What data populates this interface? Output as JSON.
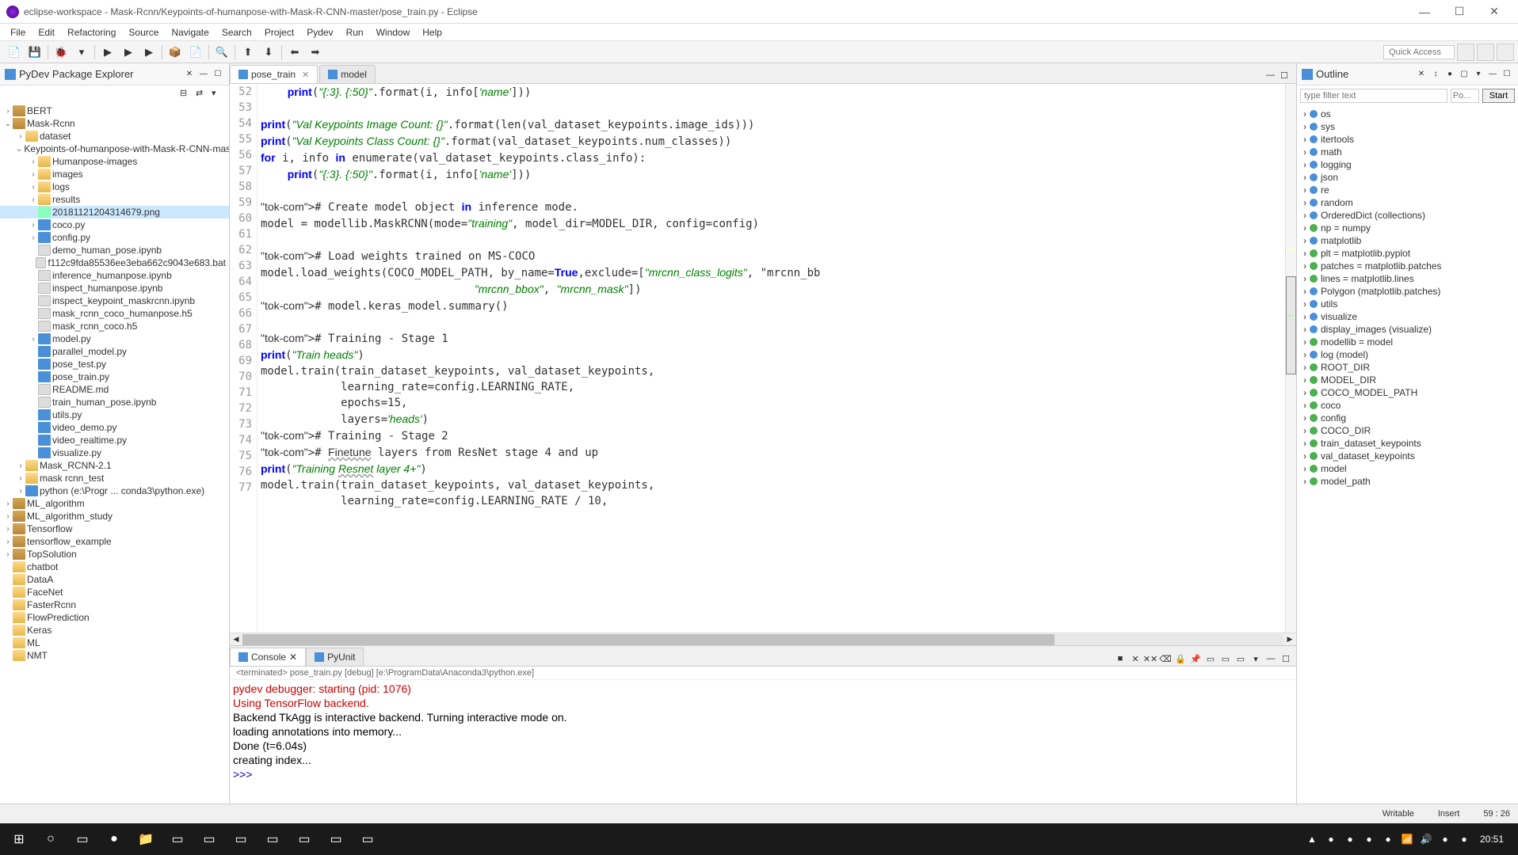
{
  "titlebar": {
    "text": "eclipse-workspace - Mask-Rcnn/Keypoints-of-humanpose-with-Mask-R-CNN-master/pose_train.py - Eclipse"
  },
  "menubar": [
    "File",
    "Edit",
    "Refactoring",
    "Source",
    "Navigate",
    "Search",
    "Project",
    "Pydev",
    "Run",
    "Window",
    "Help"
  ],
  "quick_access": "Quick Access",
  "pydev_panel_title": "PyDev Package Explorer",
  "project_tree": {
    "selected_file": "20181121204314679.png",
    "items": [
      {
        "l": 0,
        "a": "›",
        "i": "pkg",
        "t": "BERT"
      },
      {
        "l": 0,
        "a": "⌄",
        "i": "pkg",
        "t": "Mask-Rcnn"
      },
      {
        "l": 1,
        "a": "›",
        "i": "folder",
        "t": "dataset"
      },
      {
        "l": 1,
        "a": "⌄",
        "i": "folder",
        "t": "Keypoints-of-humanpose-with-Mask-R-CNN-master"
      },
      {
        "l": 2,
        "a": "›",
        "i": "folder",
        "t": "Humanpose-images"
      },
      {
        "l": 2,
        "a": "›",
        "i": "folder",
        "t": "images"
      },
      {
        "l": 2,
        "a": "›",
        "i": "folder",
        "t": "logs"
      },
      {
        "l": 2,
        "a": "›",
        "i": "folder",
        "t": "results"
      },
      {
        "l": 2,
        "a": "",
        "i": "img",
        "t": "20181121204314679.png",
        "sel": true
      },
      {
        "l": 2,
        "a": "›",
        "i": "pyfile",
        "t": "coco.py"
      },
      {
        "l": 2,
        "a": "›",
        "i": "pyfile",
        "t": "config.py"
      },
      {
        "l": 2,
        "a": "",
        "i": "file",
        "t": "demo_human_pose.ipynb"
      },
      {
        "l": 2,
        "a": "",
        "i": "file",
        "t": "f112c9fda85536ee3eba662c9043e683.bat"
      },
      {
        "l": 2,
        "a": "",
        "i": "file",
        "t": "inference_humanpose.ipynb"
      },
      {
        "l": 2,
        "a": "",
        "i": "file",
        "t": "inspect_humanpose.ipynb"
      },
      {
        "l": 2,
        "a": "",
        "i": "file",
        "t": "inspect_keypoint_maskrcnn.ipynb"
      },
      {
        "l": 2,
        "a": "",
        "i": "file",
        "t": "mask_rcnn_coco_humanpose.h5"
      },
      {
        "l": 2,
        "a": "",
        "i": "file",
        "t": "mask_rcnn_coco.h5"
      },
      {
        "l": 2,
        "a": "›",
        "i": "pyfile",
        "t": "model.py"
      },
      {
        "l": 2,
        "a": "",
        "i": "pyfile",
        "t": "parallel_model.py"
      },
      {
        "l": 2,
        "a": "",
        "i": "pyfile",
        "t": "pose_test.py"
      },
      {
        "l": 2,
        "a": "",
        "i": "pyfile",
        "t": "pose_train.py"
      },
      {
        "l": 2,
        "a": "",
        "i": "file",
        "t": "README.md"
      },
      {
        "l": 2,
        "a": "",
        "i": "file",
        "t": "train_human_pose.ipynb"
      },
      {
        "l": 2,
        "a": "",
        "i": "pyfile",
        "t": "utils.py"
      },
      {
        "l": 2,
        "a": "",
        "i": "pyfile",
        "t": "video_demo.py"
      },
      {
        "l": 2,
        "a": "",
        "i": "pyfile",
        "t": "video_realtime.py"
      },
      {
        "l": 2,
        "a": "",
        "i": "pyfile",
        "t": "visualize.py"
      },
      {
        "l": 1,
        "a": "›",
        "i": "folder",
        "t": "Mask_RCNN-2.1"
      },
      {
        "l": 1,
        "a": "›",
        "i": "folder",
        "t": "mask rcnn_test"
      },
      {
        "l": 1,
        "a": "›",
        "i": "pyfile",
        "t": "python  (e:\\Progr ... conda3\\python.exe)"
      },
      {
        "l": 0,
        "a": "›",
        "i": "pkg",
        "t": "ML_algorithm"
      },
      {
        "l": 0,
        "a": "›",
        "i": "pkg",
        "t": "ML_algorithm_study"
      },
      {
        "l": 0,
        "a": "›",
        "i": "pkg",
        "t": "Tensorflow"
      },
      {
        "l": 0,
        "a": "›",
        "i": "pkg",
        "t": "tensorflow_example"
      },
      {
        "l": 0,
        "a": "›",
        "i": "pkg",
        "t": "TopSolution"
      },
      {
        "l": 0,
        "a": "",
        "i": "folder",
        "t": "chatbot"
      },
      {
        "l": 0,
        "a": "",
        "i": "folder",
        "t": "DataA"
      },
      {
        "l": 0,
        "a": "",
        "i": "folder",
        "t": "FaceNet"
      },
      {
        "l": 0,
        "a": "",
        "i": "folder",
        "t": "FasterRcnn"
      },
      {
        "l": 0,
        "a": "",
        "i": "folder",
        "t": "FlowPrediction"
      },
      {
        "l": 0,
        "a": "",
        "i": "folder",
        "t": "Keras"
      },
      {
        "l": 0,
        "a": "",
        "i": "folder",
        "t": "ML"
      },
      {
        "l": 0,
        "a": "",
        "i": "folder",
        "t": "NMT"
      }
    ]
  },
  "editor": {
    "tabs": [
      {
        "label": "pose_train",
        "active": true
      },
      {
        "label": "model",
        "active": false
      }
    ],
    "first_line": 52,
    "code_raw": [
      "    print(\"{:3}. {:50}\".format(i, info['name']))",
      "",
      "print(\"Val Keypoints Image Count: {}\".format(len(val_dataset_keypoints.image_ids)))",
      "print(\"Val Keypoints Class Count: {}\".format(val_dataset_keypoints.num_classes))",
      "for i, info in enumerate(val_dataset_keypoints.class_info):",
      "    print(\"{:3}. {:50}\".format(i, info['name']))",
      "",
      "# Create model object in inference mode.",
      "model = modellib.MaskRCNN(mode=\"training\", model_dir=MODEL_DIR, config=config)",
      "",
      "# Load weights trained on MS-COCO",
      "model.load_weights(COCO_MODEL_PATH, by_name=True,exclude=[\"mrcnn_class_logits\", \"mrcnn_bb",
      "                                \"mrcnn_bbox\", \"mrcnn_mask\"])",
      "# model.keras_model.summary()",
      "",
      "# Training - Stage 1",
      "print(\"Train heads\")",
      "model.train(train_dataset_keypoints, val_dataset_keypoints,",
      "            learning_rate=config.LEARNING_RATE,",
      "            epochs=15,",
      "            layers='heads')",
      "# Training - Stage 2",
      "# Finetune layers from ResNet stage 4 and up",
      "print(\"Training Resnet layer 4+\")",
      "model.train(train_dataset_keypoints, val_dataset_keypoints,",
      "            learning_rate=config.LEARNING_RATE / 10,"
    ]
  },
  "console": {
    "tab_console": "Console",
    "tab_pyunit": "PyUnit",
    "status": "<terminated> pose_train.py [debug] [e:\\ProgramData\\Anaconda3\\python.exe]",
    "lines": [
      {
        "c": "red",
        "t": "pydev debugger: starting (pid: 1076)"
      },
      {
        "c": "red",
        "t": "Using TensorFlow backend."
      },
      {
        "c": "out",
        "t": "Backend TkAgg is interactive backend. Turning interactive mode on."
      },
      {
        "c": "out",
        "t": "loading annotations into memory..."
      },
      {
        "c": "out",
        "t": "Done (t=6.04s)"
      },
      {
        "c": "out",
        "t": "creating index..."
      },
      {
        "c": "out",
        "t": ""
      },
      {
        "c": "blue",
        "t": ">>> "
      }
    ]
  },
  "outline": {
    "title": "Outline",
    "filter_placeholder": "type filter text",
    "filter2_placeholder": "Po...",
    "start_btn": "Start",
    "items": [
      "os",
      "sys",
      "itertools",
      "math",
      "logging",
      "json",
      "re",
      "random",
      "OrderedDict (collections)",
      "np = numpy",
      "matplotlib",
      "plt = matplotlib.pyplot",
      "patches = matplotlib.patches",
      "lines = matplotlib.lines",
      "Polygon (matplotlib.patches)",
      "utils",
      "visualize",
      "display_images (visualize)",
      "modellib = model",
      "log (model)",
      "ROOT_DIR",
      "MODEL_DIR",
      "COCO_MODEL_PATH",
      "coco",
      "config",
      "COCO_DIR",
      "train_dataset_keypoints",
      "val_dataset_keypoints",
      "model",
      "model_path"
    ]
  },
  "status": {
    "writable": "Writable",
    "insert": "Insert",
    "pos": "59 : 26"
  },
  "clock": "20:51"
}
